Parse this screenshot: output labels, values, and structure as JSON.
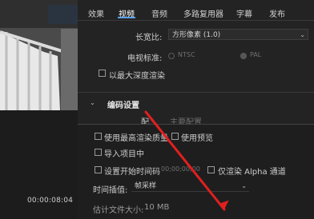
{
  "tabs": [
    {
      "label": "效果"
    },
    {
      "label": "视频"
    },
    {
      "label": "音频"
    },
    {
      "label": "多路复用器"
    },
    {
      "label": "字幕"
    },
    {
      "label": "发布"
    }
  ],
  "active_tab": "视频",
  "timecode": "00:00:08:04",
  "video": {
    "aspect_label": "长宽比:",
    "aspect_value": "方形像素 (1.0)",
    "tv_standard_label": "电视标准:",
    "ntsc": "NTSC",
    "pal": "PAL",
    "max_depth": "以最大深度渲染"
  },
  "encoding": {
    "section_title": "编码设置",
    "profile_label_partial": "配",
    "profile_value_partial": "主要配置"
  },
  "bottom": {
    "max_render_quality": "使用最高渲染质量",
    "use_preview": "使用预览",
    "import_project": "导入项目中",
    "set_start_timecode": "设置开始时间码",
    "start_timecode_value": "00;00;00;00",
    "render_alpha_only": "仅渲染 Alpha 通道",
    "time_interp_label": "时间插值:",
    "time_interp_value": "帧采样",
    "file_size_label": "估计文件大小:",
    "file_size_value": "10 MB"
  },
  "colors": {
    "accent_blue": "#5aa0e6",
    "arrow_red": "#e11f1f"
  }
}
